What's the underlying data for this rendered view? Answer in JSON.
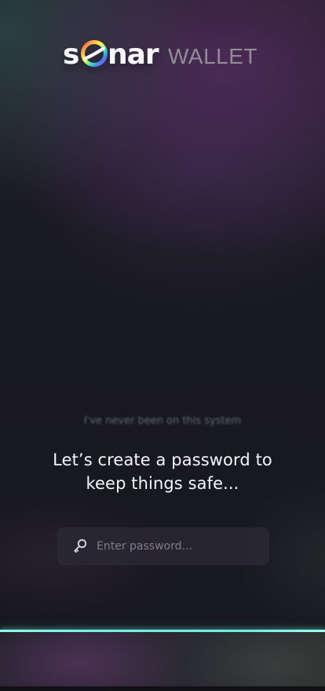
{
  "brand": {
    "fragment_s": "s",
    "fragment_nar": "nar",
    "product": "WALLET"
  },
  "icons": {
    "logo_mark": "rainbow-ring-logo-icon",
    "password_icon": "key-icon"
  },
  "colors": {
    "accent_line": "#77f1e6",
    "text_primary": "#f6f6f9",
    "text_secondary": "#807e87"
  },
  "onboarding": {
    "blurred_note": "I've never been on this system",
    "headline_line_1": "Let’s create a password to",
    "headline_line_2": "keep things safe..."
  },
  "password": {
    "value": "",
    "placeholder": "Enter password..."
  }
}
